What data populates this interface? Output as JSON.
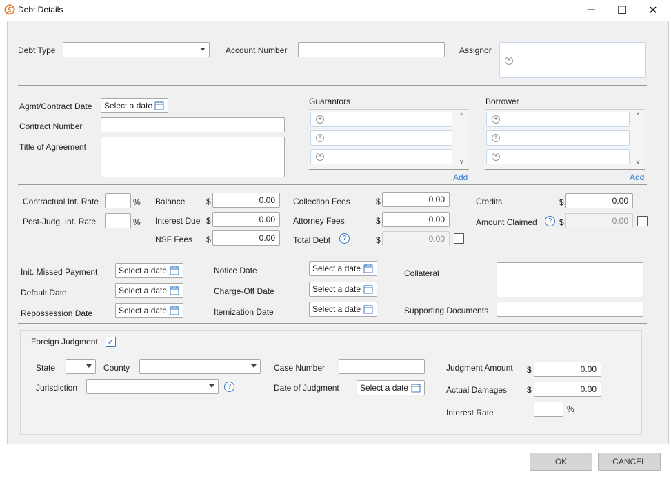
{
  "window": {
    "title": "Debt Details",
    "minimize_glyph": "─",
    "maximize_glyph": "☐",
    "close_glyph": "✕"
  },
  "icons": {
    "app": "app-logo-icon",
    "calendar": "calendar-icon",
    "add": "plus-circle-icon",
    "help": "help-icon"
  },
  "colors": {
    "link": "#2e7bcf",
    "accent": "#3a78c4"
  },
  "common": {
    "date_placeholder": "Select a date",
    "add_link": "Add",
    "currency": "$",
    "percent": "%",
    "help_glyph": "?",
    "plus_glyph": "+",
    "up_glyph": "^",
    "down_glyph": "v",
    "check_glyph": "✓"
  },
  "top": {
    "debt_type_label": "Debt Type",
    "debt_type_value": "",
    "account_number_label": "Account Number",
    "account_number_value": "",
    "assignor_label": "Assignor"
  },
  "agreement": {
    "agmt_date_label": "Agmt/Contract Date",
    "contract_number_label": "Contract Number",
    "title_label": "Title of Agreement",
    "guarantors_label": "Guarantors",
    "borrower_label": "Borrower"
  },
  "financial": {
    "contractual_rate_label": "Contractual Int. Rate",
    "post_judg_rate_label": "Post-Judg. Int. Rate",
    "balance_label": "Balance",
    "balance_value": "0.00",
    "interest_due_label": "Interest Due",
    "interest_due_value": "0.00",
    "nsf_fees_label": "NSF Fees",
    "nsf_fees_value": "0.00",
    "collection_fees_label": "Collection Fees",
    "collection_fees_value": "0.00",
    "attorney_fees_label": "Attorney Fees",
    "attorney_fees_value": "0.00",
    "total_debt_label": "Total Debt",
    "total_debt_value": "0.00",
    "credits_label": "Credits",
    "credits_value": "0.00",
    "amount_claimed_label": "Amount Claimed",
    "amount_claimed_value": "0.00"
  },
  "dates": {
    "init_missed_label": "Init. Missed Payment",
    "default_date_label": "Default Date",
    "repossession_label": "Repossession Date",
    "notice_date_label": "Notice Date",
    "charge_off_label": "Charge-Off Date",
    "itemization_label": "Itemization Date",
    "collateral_label": "Collateral",
    "supporting_docs_label": "Supporting Documents"
  },
  "judgment": {
    "foreign_judgment_label": "Foreign Judgment",
    "foreign_judgment_checked": true,
    "state_label": "State",
    "county_label": "County",
    "jurisdiction_label": "Jurisdiction",
    "case_number_label": "Case Number",
    "date_of_judgment_label": "Date of Judgment",
    "judgment_amount_label": "Judgment Amount",
    "judgment_amount_value": "0.00",
    "actual_damages_label": "Actual Damages",
    "actual_damages_value": "0.00",
    "interest_rate_label": "Interest Rate"
  },
  "footer": {
    "ok_label": "OK",
    "cancel_label": "CANCEL"
  }
}
